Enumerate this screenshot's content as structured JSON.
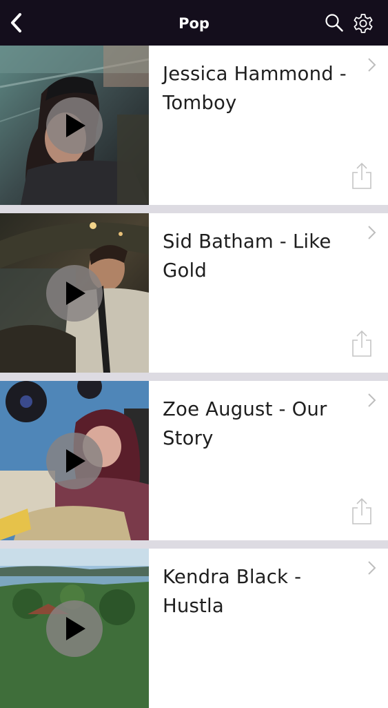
{
  "header": {
    "title": "Pop",
    "back_icon": "chevron-left-icon",
    "search_icon": "search-icon",
    "settings_icon": "gear-icon",
    "background": "#140e1c"
  },
  "videos": [
    {
      "title": "Jessica Hammond - Tomboy"
    },
    {
      "title": "Sid Batham - Like Gold"
    },
    {
      "title": "Zoe August - Our Story"
    },
    {
      "title": "Kendra Black - Hustla"
    }
  ],
  "colors": {
    "separator": "#dddbe2",
    "card": "#ffffff",
    "title_text": "#1e1e1e",
    "icon_gray": "#c4c4c4"
  }
}
